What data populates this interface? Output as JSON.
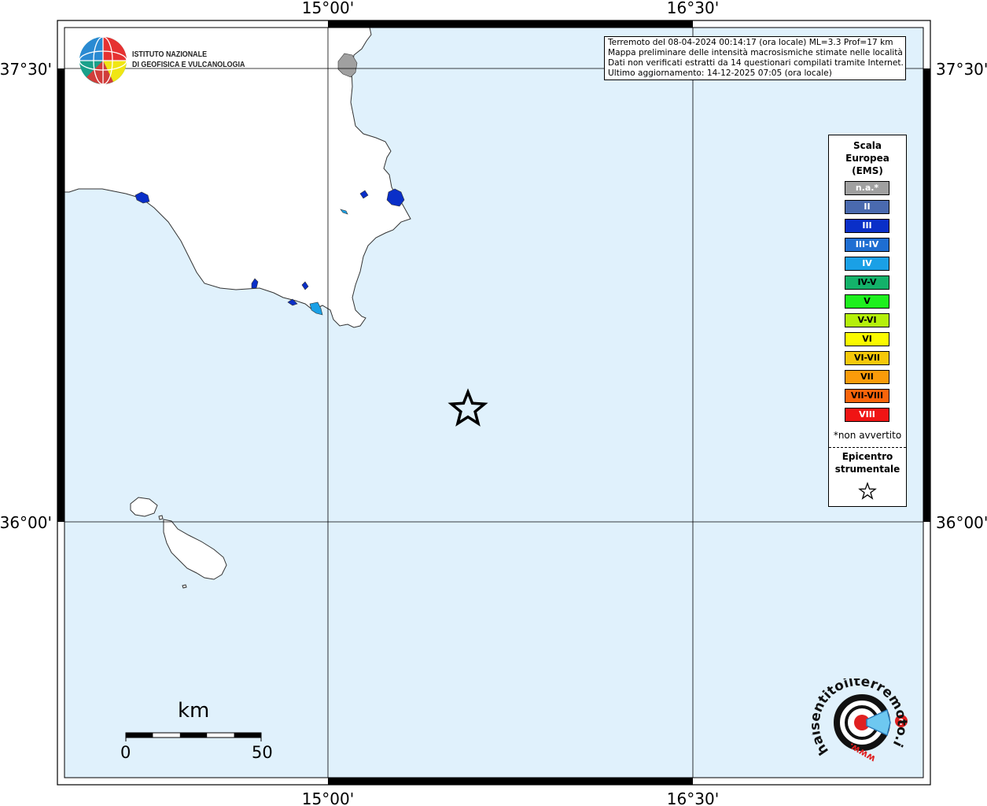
{
  "map": {
    "lon_ticks": [
      "15°00'",
      "16°30'"
    ],
    "lat_ticks": [
      "37°30'",
      "36°00'"
    ],
    "colors": {
      "sea": "#e0f1fc",
      "land": "#ffffff",
      "frame": "#000000",
      "grid": "#000000"
    }
  },
  "info_box": {
    "line1": "Terremoto del 08-04-2024 00:14:17 (ora locale) ML=3.3 Prof=17 km",
    "line2": "Mappa preliminare delle intensità macrosismiche stimate nelle località",
    "line3": "Dati non verificati estratti da 14 questionari compilati tramite Internet.",
    "line4": "Ultimo aggiornamento: 14-12-2025 07:05 (ora locale)"
  },
  "logo": {
    "line1": "ISTITUTO NAZIONALE",
    "line2": "DI GEOFISICA E VULCANOLOGIA"
  },
  "legend": {
    "title": "Scala\nEuropea\n(EMS)",
    "items": [
      {
        "label": "n.a.*",
        "color": "#a0a0a0",
        "text_color": "#ffffff"
      },
      {
        "label": "II",
        "color": "#4a6aaf",
        "text_color": "#ffffff"
      },
      {
        "label": "III",
        "color": "#0a2fc8",
        "text_color": "#ffffff"
      },
      {
        "label": "III-IV",
        "color": "#1e6ed2",
        "text_color": "#ffffff"
      },
      {
        "label": "IV",
        "color": "#1aa0e6",
        "text_color": "#ffffff"
      },
      {
        "label": "IV-V",
        "color": "#13b26a",
        "text_color": "#000000"
      },
      {
        "label": "V",
        "color": "#1ef01e",
        "text_color": "#000000"
      },
      {
        "label": "V-VI",
        "color": "#b4f00a",
        "text_color": "#000000"
      },
      {
        "label": "VI",
        "color": "#fafa00",
        "text_color": "#000000"
      },
      {
        "label": "VI-VII",
        "color": "#f5c80a",
        "text_color": "#000000"
      },
      {
        "label": "VII",
        "color": "#fa9b0a",
        "text_color": "#000000"
      },
      {
        "label": "VII-VIII",
        "color": "#fa640a",
        "text_color": "#000000"
      },
      {
        "label": "VIII",
        "color": "#f01414",
        "text_color": "#ffffff"
      }
    ],
    "note": "*non avvertito",
    "epicenter_label": "Epicentro\nstrumentale"
  },
  "scale_bar": {
    "unit": "km",
    "start": "0",
    "end": "50"
  },
  "hst_logo": {
    "text": "haisentitoilterremoto.it",
    "prefix": "www."
  }
}
